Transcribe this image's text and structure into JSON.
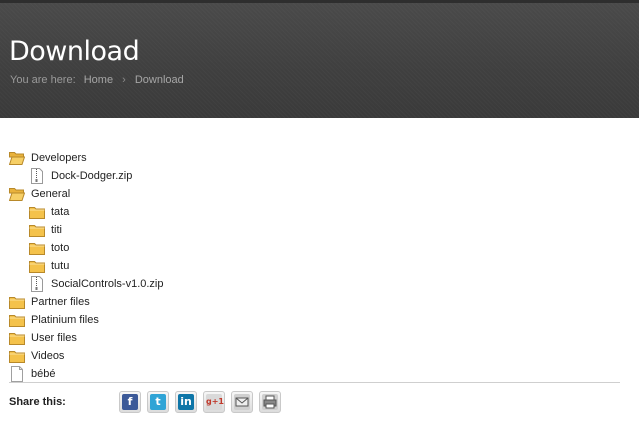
{
  "header": {
    "title": "Download",
    "breadcrumb": {
      "prefix": "You are here:",
      "items": [
        "Home",
        "Download"
      ],
      "separator": "›"
    }
  },
  "tree": [
    {
      "type": "folder-open",
      "label": "Developers",
      "level": 0
    },
    {
      "type": "zip",
      "label": "Dock-Dodger.zip",
      "level": 1
    },
    {
      "type": "folder-open",
      "label": "General",
      "level": 0
    },
    {
      "type": "folder",
      "label": "tata",
      "level": 1
    },
    {
      "type": "folder",
      "label": "titi",
      "level": 1
    },
    {
      "type": "folder",
      "label": "toto",
      "level": 1
    },
    {
      "type": "folder",
      "label": "tutu",
      "level": 1
    },
    {
      "type": "zip",
      "label": "SocialControls-v1.0.zip",
      "level": 1
    },
    {
      "type": "folder",
      "label": "Partner files",
      "level": 0
    },
    {
      "type": "folder",
      "label": "Platinium files",
      "level": 0
    },
    {
      "type": "folder",
      "label": "User files",
      "level": 0
    },
    {
      "type": "folder",
      "label": "Videos",
      "level": 0
    },
    {
      "type": "file",
      "label": "bébé",
      "level": 0
    }
  ],
  "share": {
    "label": "Share this:",
    "buttons": [
      {
        "name": "facebook-icon",
        "glyph": "f",
        "color": "#3b5998"
      },
      {
        "name": "twitter-icon",
        "glyph": "t",
        "color": "#2fa4d6"
      },
      {
        "name": "linkedin-icon",
        "glyph": "in",
        "color": "#0e76a8"
      },
      {
        "name": "google-plus-icon",
        "glyph": "g+1",
        "color": "#d9d9d9"
      },
      {
        "name": "email-icon",
        "glyph": "",
        "color": "#777777"
      },
      {
        "name": "print-icon",
        "glyph": "",
        "color": "#777777"
      }
    ]
  }
}
